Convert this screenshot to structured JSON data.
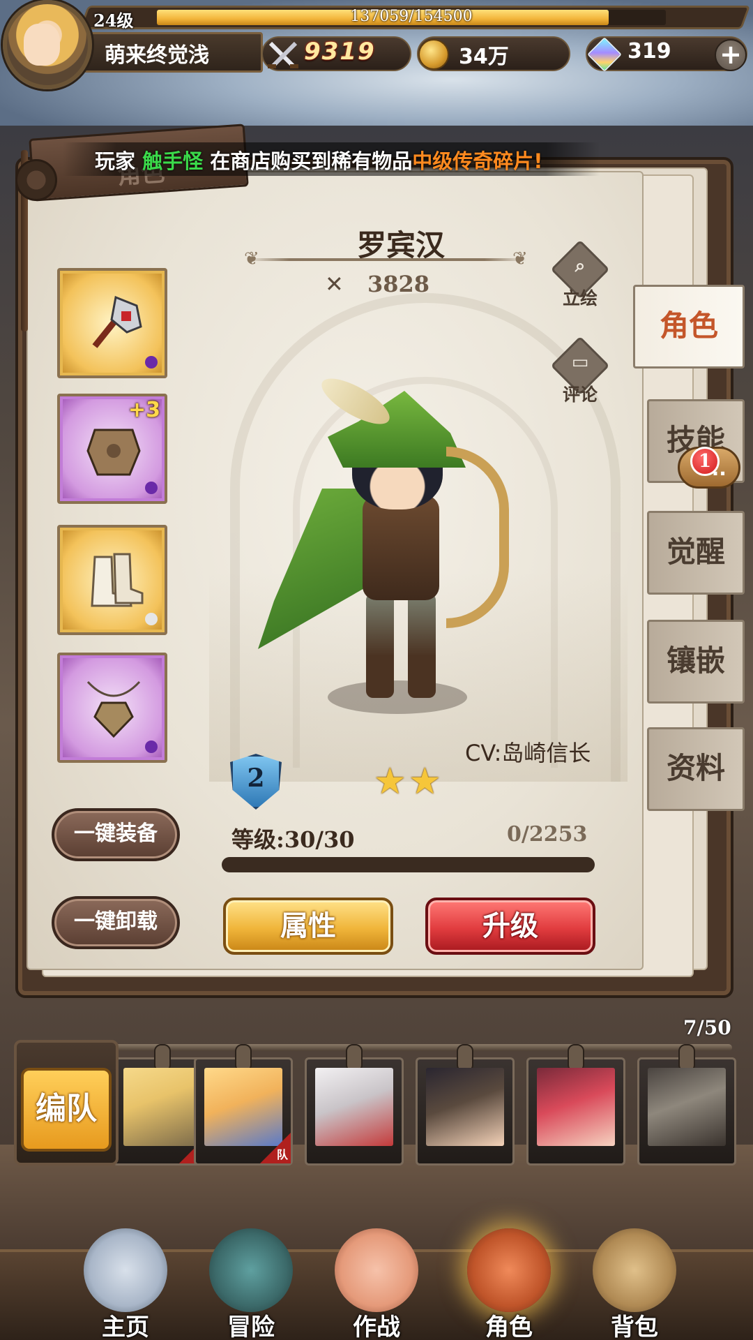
{
  "player": {
    "level": "24级",
    "xp": "137059/154500",
    "xp_fraction": 0.887,
    "name": "萌来终觉浅",
    "power": "9319",
    "gold": "34万",
    "gems": "319"
  },
  "announcement": {
    "prefix": "玩家",
    "player": "触手怪",
    "middle": "在商店购买到稀有物品",
    "item": "中级传奇碎片!"
  },
  "panel_title": "角色",
  "hero": {
    "name": "罗宾汉",
    "power": "3828",
    "cv": "CV:岛崎信长",
    "rank": "2",
    "stars": 2,
    "level_text": "等级:30/30",
    "exp_text": "0/2253"
  },
  "side_actions": {
    "portrait": "立绘",
    "comment": "评论"
  },
  "equipment": [
    {
      "icon": "mace-icon",
      "rarity": "gold"
    },
    {
      "icon": "armor-icon",
      "rarity": "purple",
      "enhance": "+3"
    },
    {
      "icon": "boots-icon",
      "rarity": "gold"
    },
    {
      "icon": "amulet-icon",
      "rarity": "purple"
    }
  ],
  "buttons": {
    "equip_all": "一键装备",
    "unequip_all": "一键卸载",
    "attributes": "属性",
    "upgrade": "升级"
  },
  "tabs": [
    {
      "label": "角色",
      "active": true
    },
    {
      "label": "技能",
      "badge": "1"
    },
    {
      "label": "觉醒"
    },
    {
      "label": "镶嵌"
    },
    {
      "label": "资料"
    }
  ],
  "roster": {
    "count": "7/50",
    "formation_label": "编队",
    "team_tag": "队",
    "heroes": [
      {
        "color": "#e8c36a",
        "in_team": true
      },
      {
        "color": "#f1b25b",
        "in_team": true
      },
      {
        "color": "#c9c4c8",
        "in_team": false
      },
      {
        "color": "#5a4a3e",
        "in_team": false
      },
      {
        "color": "#d94a5a",
        "in_team": false
      },
      {
        "color": "#8e877c",
        "in_team": false
      }
    ]
  },
  "nav": [
    {
      "label": "主页",
      "icon": "home-icon",
      "color": "#a9b6c8"
    },
    {
      "label": "冒险",
      "icon": "adventure-icon",
      "color": "#3c6a6a"
    },
    {
      "label": "作战",
      "icon": "battle-icon",
      "color": "#e59a7a"
    },
    {
      "label": "角色",
      "icon": "character-book-icon",
      "color": "#c0552a",
      "active": true
    },
    {
      "label": "背包",
      "icon": "backpack-icon",
      "color": "#b08a54"
    }
  ],
  "colors": {
    "accent_gold": "#f2b43a",
    "upgrade_red": "#e13c3f",
    "active_tab_text": "#c4562a",
    "announce_player": "#3bd94a",
    "announce_item": "#ff8a1f"
  }
}
